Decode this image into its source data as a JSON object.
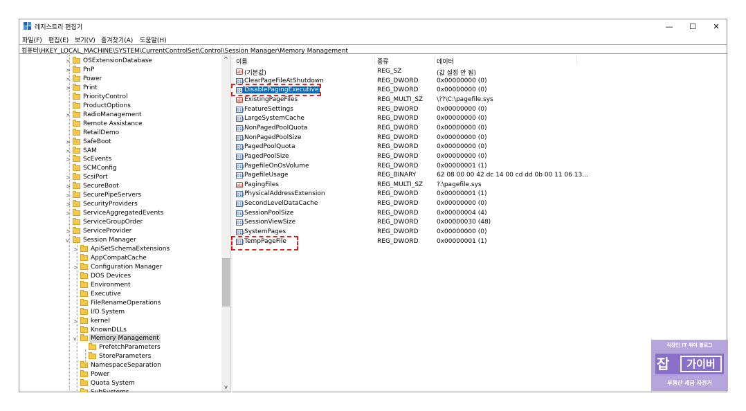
{
  "window": {
    "title": "레지스트리 편집기",
    "minimize": "—",
    "maximize": "☐",
    "close": "✕"
  },
  "menu": [
    "파일(F)",
    "편집(E)",
    "보기(V)",
    "즐겨찾기(A)",
    "도움말(H)"
  ],
  "address": "컴퓨터\\HKEY_LOCAL_MACHINE\\SYSTEM\\CurrentControlSet\\Control\\Session Manager\\Memory Management",
  "tree": [
    {
      "label": "OSExtensionDatabase",
      "level": 0,
      "expander": ">"
    },
    {
      "label": "PnP",
      "level": 0,
      "expander": ">"
    },
    {
      "label": "Power",
      "level": 0,
      "expander": ">"
    },
    {
      "label": "Print",
      "level": 0,
      "expander": ">"
    },
    {
      "label": "PriorityControl",
      "level": 0,
      "expander": ""
    },
    {
      "label": "ProductOptions",
      "level": 0,
      "expander": ""
    },
    {
      "label": "RadioManagement",
      "level": 0,
      "expander": ">"
    },
    {
      "label": "Remote Assistance",
      "level": 0,
      "expander": ""
    },
    {
      "label": "RetailDemo",
      "level": 0,
      "expander": ""
    },
    {
      "label": "SafeBoot",
      "level": 0,
      "expander": ">"
    },
    {
      "label": "SAM",
      "level": 0,
      "expander": ">"
    },
    {
      "label": "ScEvents",
      "level": 0,
      "expander": ">"
    },
    {
      "label": "SCMConfig",
      "level": 0,
      "expander": ""
    },
    {
      "label": "ScsiPort",
      "level": 0,
      "expander": ">"
    },
    {
      "label": "SecureBoot",
      "level": 0,
      "expander": ">"
    },
    {
      "label": "SecurePipeServers",
      "level": 0,
      "expander": ">"
    },
    {
      "label": "SecurityProviders",
      "level": 0,
      "expander": ">"
    },
    {
      "label": "ServiceAggregatedEvents",
      "level": 0,
      "expander": ">"
    },
    {
      "label": "ServiceGroupOrder",
      "level": 0,
      "expander": ""
    },
    {
      "label": "ServiceProvider",
      "level": 0,
      "expander": ">"
    },
    {
      "label": "Session Manager",
      "level": 0,
      "expander": "v"
    },
    {
      "label": "ApiSetSchemaExtensions",
      "level": 1,
      "expander": ">"
    },
    {
      "label": "AppCompatCache",
      "level": 1,
      "expander": ""
    },
    {
      "label": "Configuration Manager",
      "level": 1,
      "expander": ">"
    },
    {
      "label": "DOS Devices",
      "level": 1,
      "expander": ""
    },
    {
      "label": "Environment",
      "level": 1,
      "expander": ""
    },
    {
      "label": "Executive",
      "level": 1,
      "expander": ""
    },
    {
      "label": "FileRenameOperations",
      "level": 1,
      "expander": ""
    },
    {
      "label": "I/O System",
      "level": 1,
      "expander": ""
    },
    {
      "label": "kernel",
      "level": 1,
      "expander": ">"
    },
    {
      "label": "KnownDLLs",
      "level": 1,
      "expander": ""
    },
    {
      "label": "Memory Management",
      "level": 1,
      "expander": "v",
      "selected": true
    },
    {
      "label": "PrefetchParameters",
      "level": 2,
      "expander": ""
    },
    {
      "label": "StoreParameters",
      "level": 2,
      "expander": ""
    },
    {
      "label": "NamespaceSeparation",
      "level": 1,
      "expander": ""
    },
    {
      "label": "Power",
      "level": 1,
      "expander": ""
    },
    {
      "label": "Quota System",
      "level": 1,
      "expander": ""
    },
    {
      "label": "SubSystems",
      "level": 1,
      "expander": ""
    }
  ],
  "scroll": {
    "up": "^",
    "down": "v"
  },
  "columns": {
    "name": "이름",
    "type": "종류",
    "data": "데이터"
  },
  "values": [
    {
      "icon": "ab",
      "kind": "str",
      "name": "(기본값)",
      "type": "REG_SZ",
      "data": "(값 설정 안 됨)"
    },
    {
      "icon": "011",
      "kind": "bin",
      "name": "ClearPageFileAtShutdown",
      "type": "REG_DWORD",
      "data": "0x00000000 (0)"
    },
    {
      "icon": "011",
      "kind": "bin",
      "name": "DisablePagingExecutive",
      "type": "REG_DWORD",
      "data": "0x00000000 (0)",
      "selected": true
    },
    {
      "icon": "ab",
      "kind": "str",
      "name": "ExistingPageFiles",
      "type": "REG_MULTI_SZ",
      "data": "\\??\\C:\\pagefile.sys"
    },
    {
      "icon": "011",
      "kind": "bin",
      "name": "FeatureSettings",
      "type": "REG_DWORD",
      "data": "0x00000000 (0)"
    },
    {
      "icon": "011",
      "kind": "bin",
      "name": "LargeSystemCache",
      "type": "REG_DWORD",
      "data": "0x00000000 (0)"
    },
    {
      "icon": "011",
      "kind": "bin",
      "name": "NonPagedPoolQuota",
      "type": "REG_DWORD",
      "data": "0x00000000 (0)"
    },
    {
      "icon": "011",
      "kind": "bin",
      "name": "NonPagedPoolSize",
      "type": "REG_DWORD",
      "data": "0x00000000 (0)"
    },
    {
      "icon": "011",
      "kind": "bin",
      "name": "PagedPoolQuota",
      "type": "REG_DWORD",
      "data": "0x00000000 (0)"
    },
    {
      "icon": "011",
      "kind": "bin",
      "name": "PagedPoolSize",
      "type": "REG_DWORD",
      "data": "0x00000000 (0)"
    },
    {
      "icon": "011",
      "kind": "bin",
      "name": "PagefileOnOsVolume",
      "type": "REG_DWORD",
      "data": "0x00000001 (1)"
    },
    {
      "icon": "011",
      "kind": "bin",
      "name": "PagefileUsage",
      "type": "REG_BINARY",
      "data": "62 08 00 00 42 dc 14 00 cd dd 0b 00 11 06 13..."
    },
    {
      "icon": "ab",
      "kind": "str",
      "name": "PagingFiles",
      "type": "REG_MULTI_SZ",
      "data": "?:\\pagefile.sys"
    },
    {
      "icon": "011",
      "kind": "bin",
      "name": "PhysicalAddressExtension",
      "type": "REG_DWORD",
      "data": "0x00000001 (1)"
    },
    {
      "icon": "011",
      "kind": "bin",
      "name": "SecondLevelDataCache",
      "type": "REG_DWORD",
      "data": "0x00000000 (0)"
    },
    {
      "icon": "011",
      "kind": "bin",
      "name": "SessionPoolSize",
      "type": "REG_DWORD",
      "data": "0x00000004 (4)"
    },
    {
      "icon": "011",
      "kind": "bin",
      "name": "SessionViewSize",
      "type": "REG_DWORD",
      "data": "0x00000030 (48)"
    },
    {
      "icon": "011",
      "kind": "bin",
      "name": "SystemPages",
      "type": "REG_DWORD",
      "data": "0x00000000 (0)"
    },
    {
      "icon": "011",
      "kind": "bin",
      "name": "TempPageFile",
      "type": "REG_DWORD",
      "data": "0x00000001 (1)"
    }
  ],
  "badge": {
    "top": "직장인 IT 취미 블로그",
    "big": "잡",
    "box": "가이버",
    "bottom": "부동산 세금 자전거"
  },
  "colors": {
    "highlight": "#e02020",
    "selection": "#0a64b4",
    "badge": "#b6a5dc"
  }
}
